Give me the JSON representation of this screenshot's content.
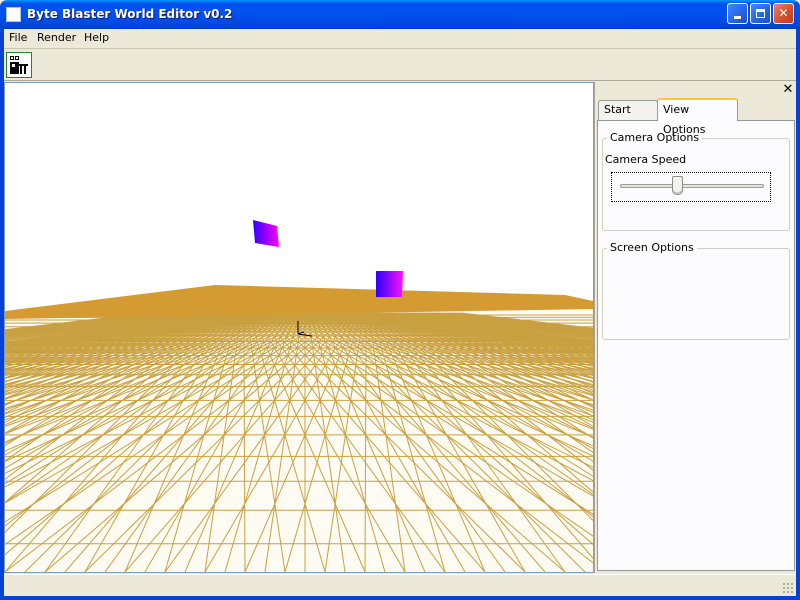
{
  "window": {
    "title": "Byte Blaster World Editor v0.2",
    "controls": {
      "minimize_icon": "minimize-icon",
      "maximize_icon": "maximize-icon",
      "close_label": "✕"
    }
  },
  "menubar": {
    "items": [
      {
        "label": "File"
      },
      {
        "label": "Render"
      },
      {
        "label": "Help"
      }
    ]
  },
  "toolbar": {
    "buttons": [
      {
        "icon": "tool-icon"
      }
    ]
  },
  "viewport": {
    "ground_color": "#d49b33",
    "grid_color": "#c9a040",
    "cube_colors": [
      "#ff00ff",
      "#3300ff"
    ],
    "axis_marker_color": "#000000"
  },
  "sidepanel": {
    "close_label": "✕",
    "tabs": [
      {
        "label": "Start Page",
        "selected": false
      },
      {
        "label": "View Options",
        "selected": true
      }
    ],
    "camera_options": {
      "title": "Camera Options",
      "camera_speed_label": "Camera Speed",
      "camera_speed_value": 0.39
    },
    "screen_options": {
      "title": "Screen Options"
    }
  }
}
